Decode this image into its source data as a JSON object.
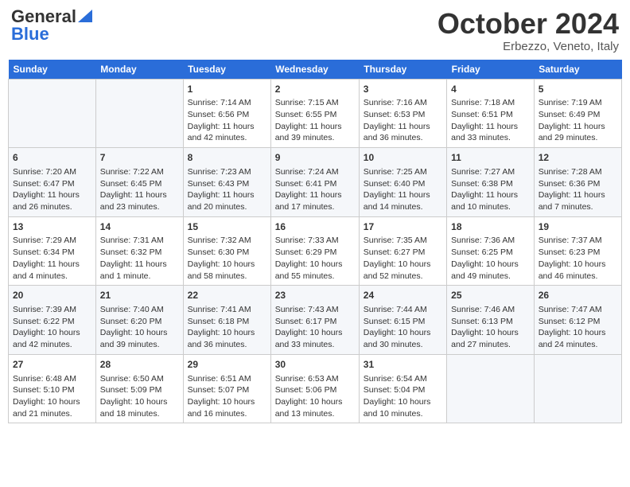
{
  "header": {
    "logo_general": "General",
    "logo_blue": "Blue",
    "title": "October 2024",
    "location": "Erbezzo, Veneto, Italy"
  },
  "weekdays": [
    "Sunday",
    "Monday",
    "Tuesday",
    "Wednesday",
    "Thursday",
    "Friday",
    "Saturday"
  ],
  "weeks": [
    [
      {
        "day": "",
        "text": ""
      },
      {
        "day": "",
        "text": ""
      },
      {
        "day": "1",
        "text": "Sunrise: 7:14 AM\nSunset: 6:56 PM\nDaylight: 11 hours and 42 minutes."
      },
      {
        "day": "2",
        "text": "Sunrise: 7:15 AM\nSunset: 6:55 PM\nDaylight: 11 hours and 39 minutes."
      },
      {
        "day": "3",
        "text": "Sunrise: 7:16 AM\nSunset: 6:53 PM\nDaylight: 11 hours and 36 minutes."
      },
      {
        "day": "4",
        "text": "Sunrise: 7:18 AM\nSunset: 6:51 PM\nDaylight: 11 hours and 33 minutes."
      },
      {
        "day": "5",
        "text": "Sunrise: 7:19 AM\nSunset: 6:49 PM\nDaylight: 11 hours and 29 minutes."
      }
    ],
    [
      {
        "day": "6",
        "text": "Sunrise: 7:20 AM\nSunset: 6:47 PM\nDaylight: 11 hours and 26 minutes."
      },
      {
        "day": "7",
        "text": "Sunrise: 7:22 AM\nSunset: 6:45 PM\nDaylight: 11 hours and 23 minutes."
      },
      {
        "day": "8",
        "text": "Sunrise: 7:23 AM\nSunset: 6:43 PM\nDaylight: 11 hours and 20 minutes."
      },
      {
        "day": "9",
        "text": "Sunrise: 7:24 AM\nSunset: 6:41 PM\nDaylight: 11 hours and 17 minutes."
      },
      {
        "day": "10",
        "text": "Sunrise: 7:25 AM\nSunset: 6:40 PM\nDaylight: 11 hours and 14 minutes."
      },
      {
        "day": "11",
        "text": "Sunrise: 7:27 AM\nSunset: 6:38 PM\nDaylight: 11 hours and 10 minutes."
      },
      {
        "day": "12",
        "text": "Sunrise: 7:28 AM\nSunset: 6:36 PM\nDaylight: 11 hours and 7 minutes."
      }
    ],
    [
      {
        "day": "13",
        "text": "Sunrise: 7:29 AM\nSunset: 6:34 PM\nDaylight: 11 hours and 4 minutes."
      },
      {
        "day": "14",
        "text": "Sunrise: 7:31 AM\nSunset: 6:32 PM\nDaylight: 11 hours and 1 minute."
      },
      {
        "day": "15",
        "text": "Sunrise: 7:32 AM\nSunset: 6:30 PM\nDaylight: 10 hours and 58 minutes."
      },
      {
        "day": "16",
        "text": "Sunrise: 7:33 AM\nSunset: 6:29 PM\nDaylight: 10 hours and 55 minutes."
      },
      {
        "day": "17",
        "text": "Sunrise: 7:35 AM\nSunset: 6:27 PM\nDaylight: 10 hours and 52 minutes."
      },
      {
        "day": "18",
        "text": "Sunrise: 7:36 AM\nSunset: 6:25 PM\nDaylight: 10 hours and 49 minutes."
      },
      {
        "day": "19",
        "text": "Sunrise: 7:37 AM\nSunset: 6:23 PM\nDaylight: 10 hours and 46 minutes."
      }
    ],
    [
      {
        "day": "20",
        "text": "Sunrise: 7:39 AM\nSunset: 6:22 PM\nDaylight: 10 hours and 42 minutes."
      },
      {
        "day": "21",
        "text": "Sunrise: 7:40 AM\nSunset: 6:20 PM\nDaylight: 10 hours and 39 minutes."
      },
      {
        "day": "22",
        "text": "Sunrise: 7:41 AM\nSunset: 6:18 PM\nDaylight: 10 hours and 36 minutes."
      },
      {
        "day": "23",
        "text": "Sunrise: 7:43 AM\nSunset: 6:17 PM\nDaylight: 10 hours and 33 minutes."
      },
      {
        "day": "24",
        "text": "Sunrise: 7:44 AM\nSunset: 6:15 PM\nDaylight: 10 hours and 30 minutes."
      },
      {
        "day": "25",
        "text": "Sunrise: 7:46 AM\nSunset: 6:13 PM\nDaylight: 10 hours and 27 minutes."
      },
      {
        "day": "26",
        "text": "Sunrise: 7:47 AM\nSunset: 6:12 PM\nDaylight: 10 hours and 24 minutes."
      }
    ],
    [
      {
        "day": "27",
        "text": "Sunrise: 6:48 AM\nSunset: 5:10 PM\nDaylight: 10 hours and 21 minutes."
      },
      {
        "day": "28",
        "text": "Sunrise: 6:50 AM\nSunset: 5:09 PM\nDaylight: 10 hours and 18 minutes."
      },
      {
        "day": "29",
        "text": "Sunrise: 6:51 AM\nSunset: 5:07 PM\nDaylight: 10 hours and 16 minutes."
      },
      {
        "day": "30",
        "text": "Sunrise: 6:53 AM\nSunset: 5:06 PM\nDaylight: 10 hours and 13 minutes."
      },
      {
        "day": "31",
        "text": "Sunrise: 6:54 AM\nSunset: 5:04 PM\nDaylight: 10 hours and 10 minutes."
      },
      {
        "day": "",
        "text": ""
      },
      {
        "day": "",
        "text": ""
      }
    ]
  ]
}
